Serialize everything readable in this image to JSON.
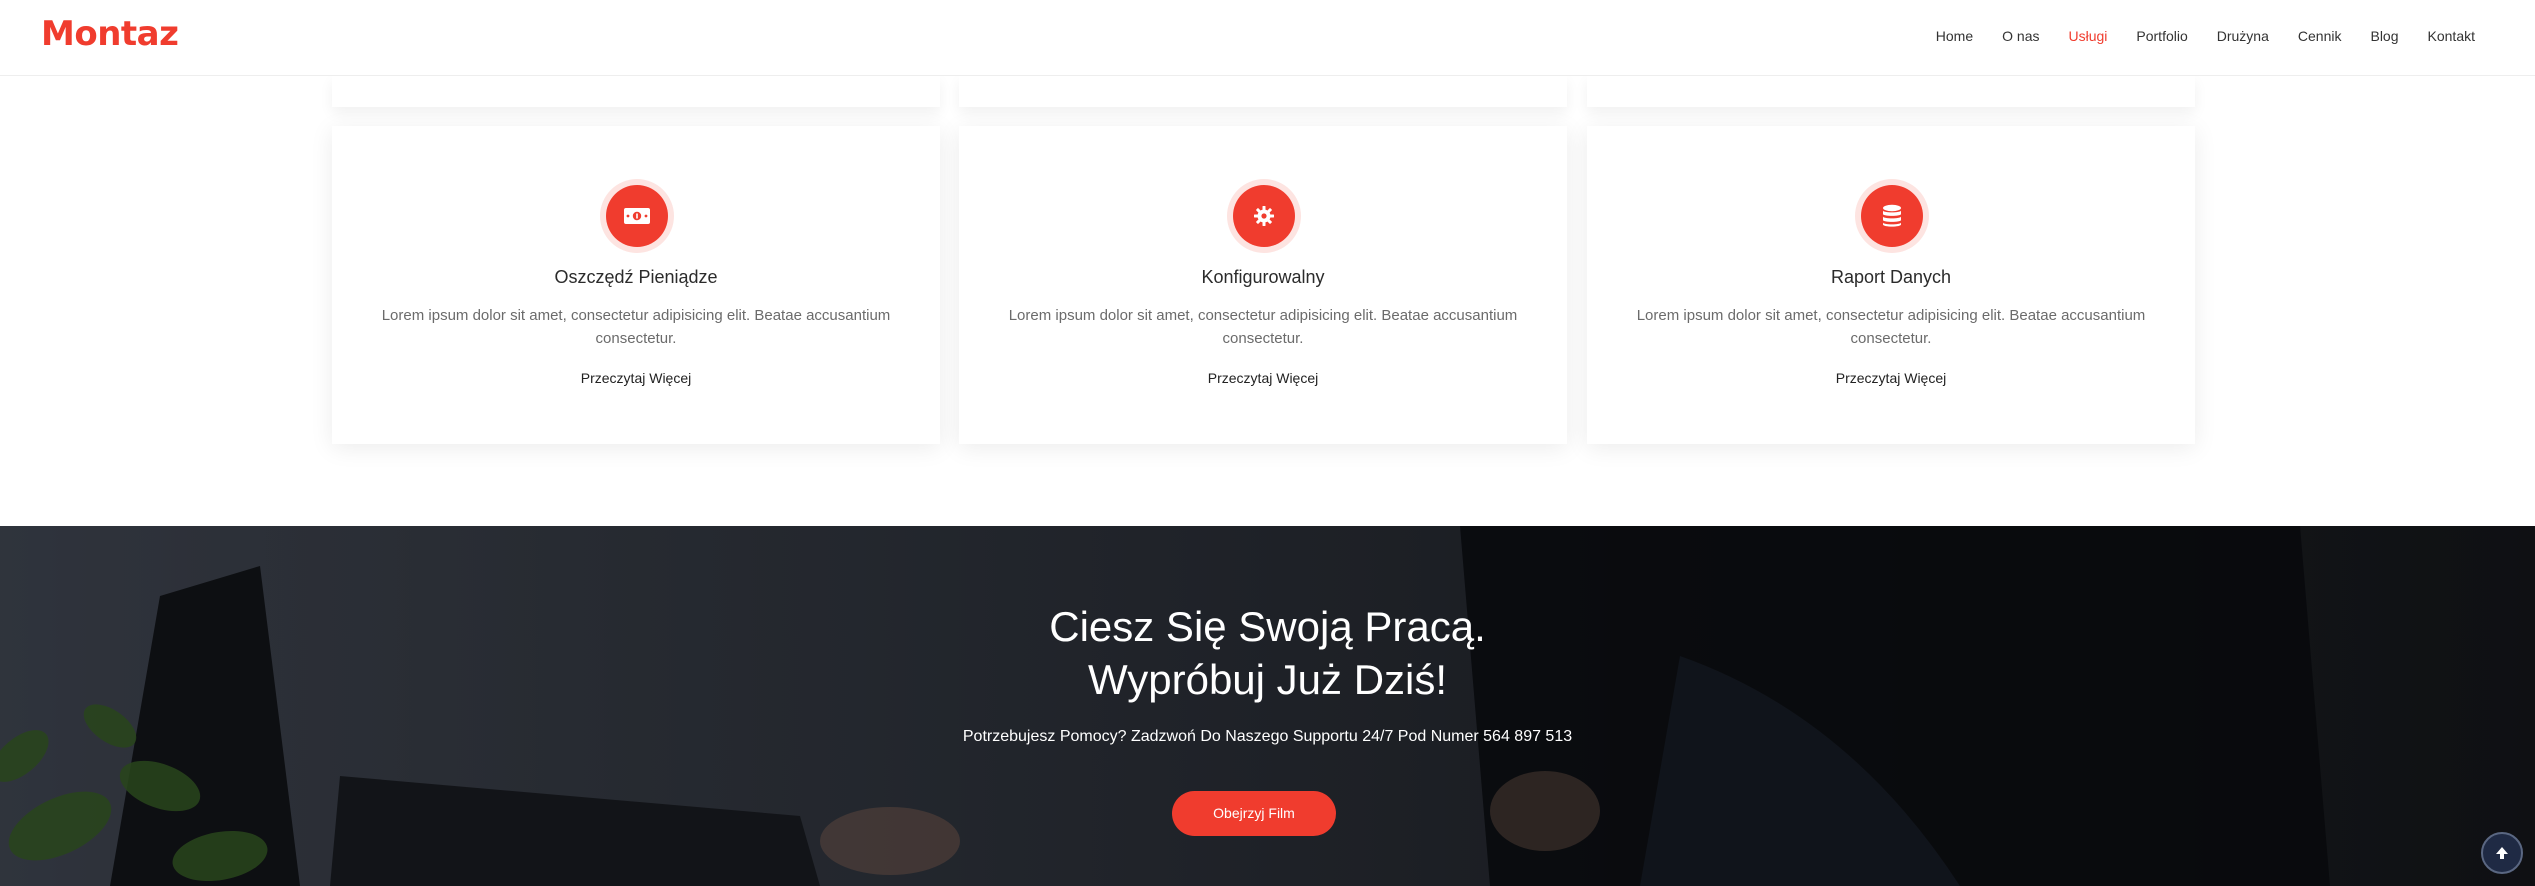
{
  "brand": {
    "logo": "Montaz",
    "accent_color": "#f03c2e"
  },
  "nav": {
    "items": [
      {
        "label": "Home",
        "active": false
      },
      {
        "label": "O nas",
        "active": false
      },
      {
        "label": "Usługi",
        "active": true
      },
      {
        "label": "Portfolio",
        "active": false
      },
      {
        "label": "Drużyna",
        "active": false
      },
      {
        "label": "Cennik",
        "active": false
      },
      {
        "label": "Blog",
        "active": false
      },
      {
        "label": "Kontakt",
        "active": false
      }
    ]
  },
  "services": {
    "cards": [
      {
        "icon": "money-bill-icon",
        "title": "Oszczędź Pieniądze",
        "text": "Lorem ipsum dolor sit amet, consectetur adipisicing elit. Beatae accusantium consectetur.",
        "link": "Przeczytaj Więcej"
      },
      {
        "icon": "gear-icon",
        "title": "Konfigurowalny",
        "text": "Lorem ipsum dolor sit amet, consectetur adipisicing elit. Beatae accusantium consectetur.",
        "link": "Przeczytaj Więcej"
      },
      {
        "icon": "database-icon",
        "title": "Raport Danych",
        "text": "Lorem ipsum dolor sit amet, consectetur adipisicing elit. Beatae accusantium consectetur.",
        "link": "Przeczytaj Więcej"
      }
    ]
  },
  "hero": {
    "title_line1": "Ciesz Się Swoją Pracą.",
    "title_line2": "Wypróbuj Już Dziś!",
    "subtitle": "Potrzebujesz Pomocy? Zadzwoń Do Naszego Supportu 24/7 Pod Numer 564 897 513",
    "button": "Obejrzyj Film"
  },
  "scroll_top": {
    "icon": "arrow-up-icon"
  }
}
